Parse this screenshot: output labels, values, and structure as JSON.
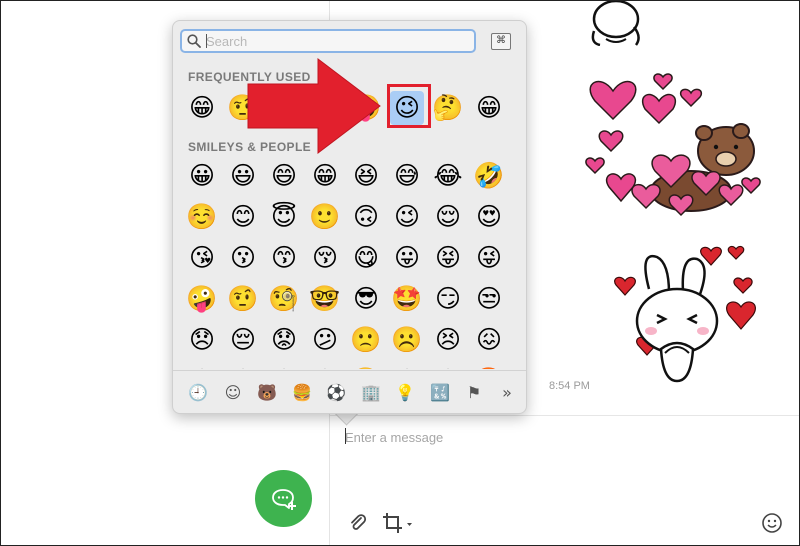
{
  "chat": {
    "timestamp": "8:54 PM",
    "message_placeholder": "Enter a message"
  },
  "icons": {
    "fab": "new-chat-icon",
    "attach": "paperclip-icon",
    "crop": "crop-icon",
    "emoji_toggle": "smiley-icon"
  },
  "emoji_picker": {
    "search_placeholder": "Search",
    "viewer_symbol": "⌘",
    "frequently_used": {
      "title": "FREQUENTLY USED",
      "items": [
        "😁",
        "🤨",
        "😊",
        "😶",
        "🤪",
        "😉",
        "🤔",
        "😁"
      ],
      "selected_index": 5
    },
    "smileys": {
      "title": "SMILEYS & PEOPLE",
      "rows": [
        [
          "😀",
          "😃",
          "😄",
          "😁",
          "😆",
          "😅",
          "😂",
          "🤣"
        ],
        [
          "☺️",
          "😊",
          "😇",
          "🙂",
          "🙃",
          "😉",
          "😌",
          "😍"
        ],
        [
          "😘",
          "😗",
          "😙",
          "😚",
          "😋",
          "😛",
          "😝",
          "😜"
        ],
        [
          "🤪",
          "🤨",
          "🧐",
          "🤓",
          "😎",
          "🤩",
          "😏",
          "😒"
        ],
        [
          "😞",
          "😔",
          "😟",
          "😕",
          "🙁",
          "☹️",
          "😣",
          "😖"
        ],
        [
          "😫",
          "😩",
          "😢",
          "😭",
          "😤",
          "😠",
          "😡",
          "🤬"
        ]
      ]
    },
    "categories": [
      {
        "icon": "🕘",
        "name": "recent-icon"
      },
      {
        "icon": "☺",
        "name": "smileys-icon"
      },
      {
        "icon": "🐻",
        "name": "animals-icon"
      },
      {
        "icon": "🍔",
        "name": "food-icon"
      },
      {
        "icon": "⚽",
        "name": "activity-icon"
      },
      {
        "icon": "🏢",
        "name": "travel-icon"
      },
      {
        "icon": "💡",
        "name": "objects-icon"
      },
      {
        "icon": "🔣",
        "name": "symbols-icon"
      },
      {
        "icon": "⚑",
        "name": "flags-icon"
      },
      {
        "icon": "»",
        "name": "more-icon"
      }
    ]
  },
  "colors": {
    "accent_green": "#3eb34f",
    "selection_blue": "#aacdf5",
    "annotation_red": "#e2202d"
  }
}
